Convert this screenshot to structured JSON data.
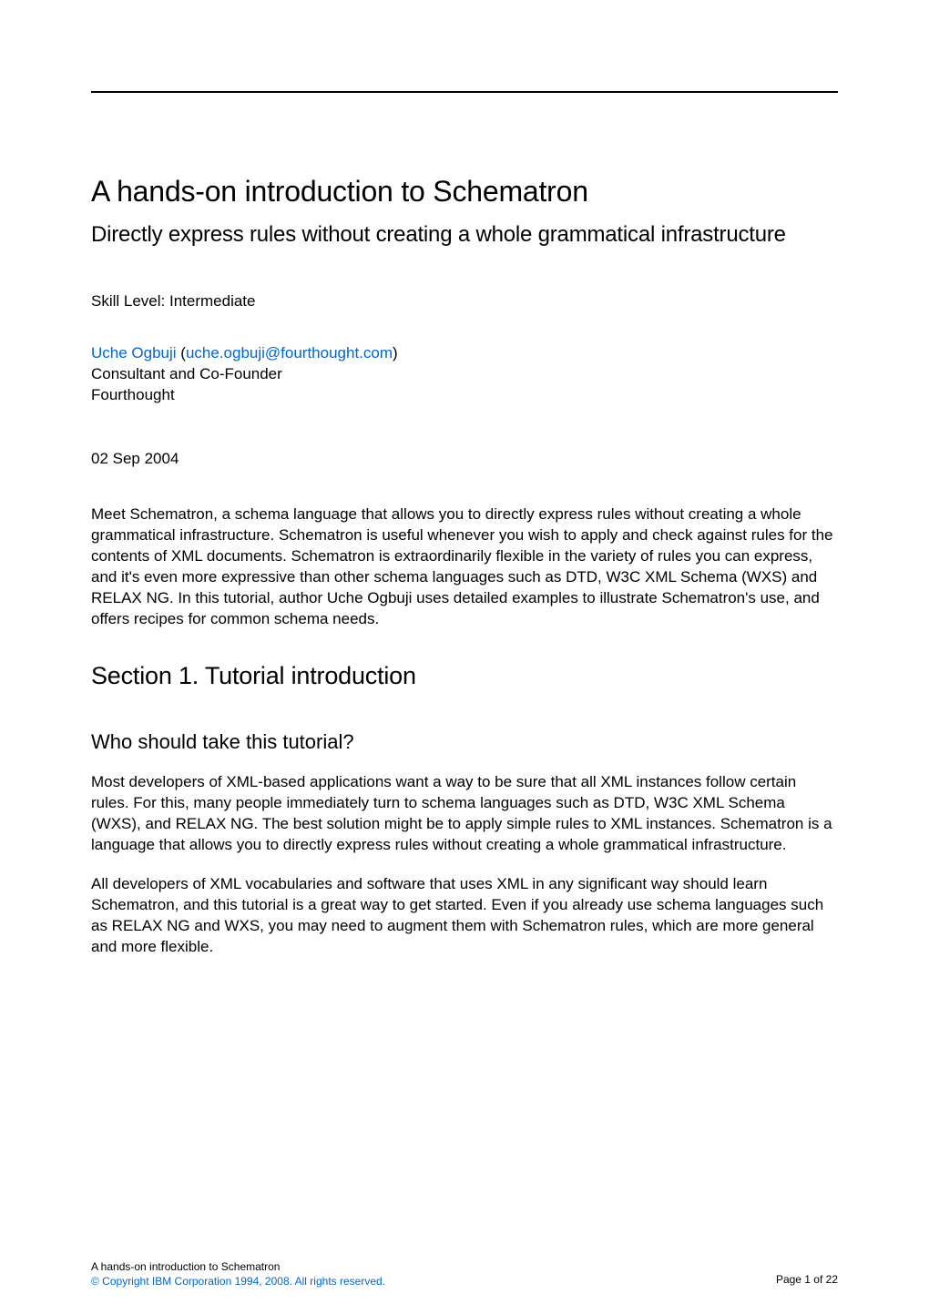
{
  "main_title": "A hands-on introduction to Schematron",
  "subtitle": "Directly express rules without creating a whole grammatical infrastructure",
  "skill_level_label": "Skill Level: Intermediate",
  "author": {
    "name": "Uche Ogbuji",
    "email": "uche.ogbuji@fourthought.com",
    "role": "Consultant and Co-Founder",
    "org": "Fourthought"
  },
  "date": "02 Sep 2004",
  "abstract": "Meet Schematron, a schema language that allows you to directly express rules without creating a whole grammatical infrastructure. Schematron is useful whenever you wish to apply and check against rules for the contents of XML documents. Schematron is extraordinarily flexible in the variety of rules you can express, and it's even more expressive than other schema languages such as DTD, W3C XML Schema (WXS) and RELAX NG. In this tutorial, author Uche Ogbuji uses detailed examples to illustrate Schematron's use, and offers recipes for common schema needs.",
  "section_title": "Section 1. Tutorial introduction",
  "subsection_title": "Who should take this tutorial?",
  "body_para_1": "Most developers of XML-based applications want a way to be sure that all XML instances follow certain rules. For this, many people immediately turn to schema languages such as DTD, W3C XML Schema (WXS), and RELAX NG. The best solution might be to apply simple rules to XML instances. Schematron is a language that allows you to directly express rules without creating a whole grammatical infrastructure.",
  "body_para_2": "All developers of XML vocabularies and software that uses XML in any significant way should learn Schematron, and this tutorial is a great way to get started. Even if you already use schema languages such as RELAX NG and WXS, you may need to augment them with Schematron rules, which are more general and more flexible.",
  "footer": {
    "doc_title": "A hands-on introduction to Schematron",
    "copyright": "© Copyright IBM Corporation 1994, 2008. All rights reserved.",
    "page_label": "Page 1 of 22"
  }
}
